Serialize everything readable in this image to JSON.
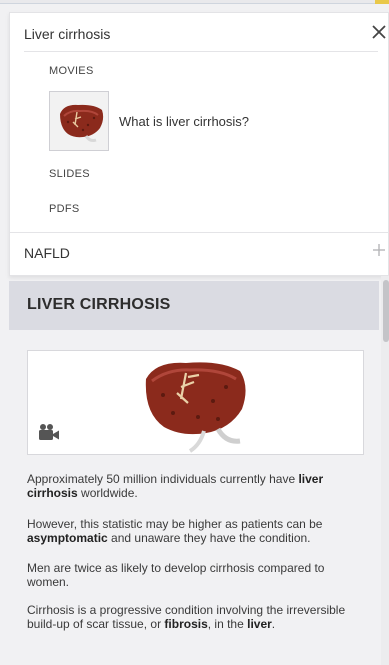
{
  "panel": {
    "topic_title": "Liver cirrhosis",
    "sections": {
      "movies": "MOVIES",
      "slides": "SLIDES",
      "pdfs": "PDFS"
    },
    "movie_item": {
      "title": "What is liver cirrhosis?"
    },
    "next_topic": "NAFLD"
  },
  "content": {
    "title": "LIVER CIRRHOSIS",
    "paragraphs": [
      {
        "before": "Approximately 50 million individuals currently have ",
        "bold": "liver cirrhosis",
        "after": " worldwide."
      },
      {
        "before": "However, this statistic may be higher as patients can be ",
        "bold": "asymptomatic",
        "after": " and unaware they have the condition."
      },
      {
        "before": "Men are twice as likely to develop cirrhosis compared to women.",
        "bold": "",
        "after": ""
      },
      {
        "before": "Cirrhosis is a progressive condition involving the irreversible build-up of scar tissue, or ",
        "bold": "fibrosis",
        "after": ", in the ",
        "bold2": "liver",
        "after2": "."
      }
    ]
  },
  "colors": {
    "header_bg": "#dadbe2",
    "panel_bg": "#ffffff",
    "liver": "#8b2a1c",
    "accent_strip": "#e9c84a"
  },
  "icons": {
    "close": "close-icon",
    "add": "plus-icon",
    "media": "video-camera-icon"
  }
}
